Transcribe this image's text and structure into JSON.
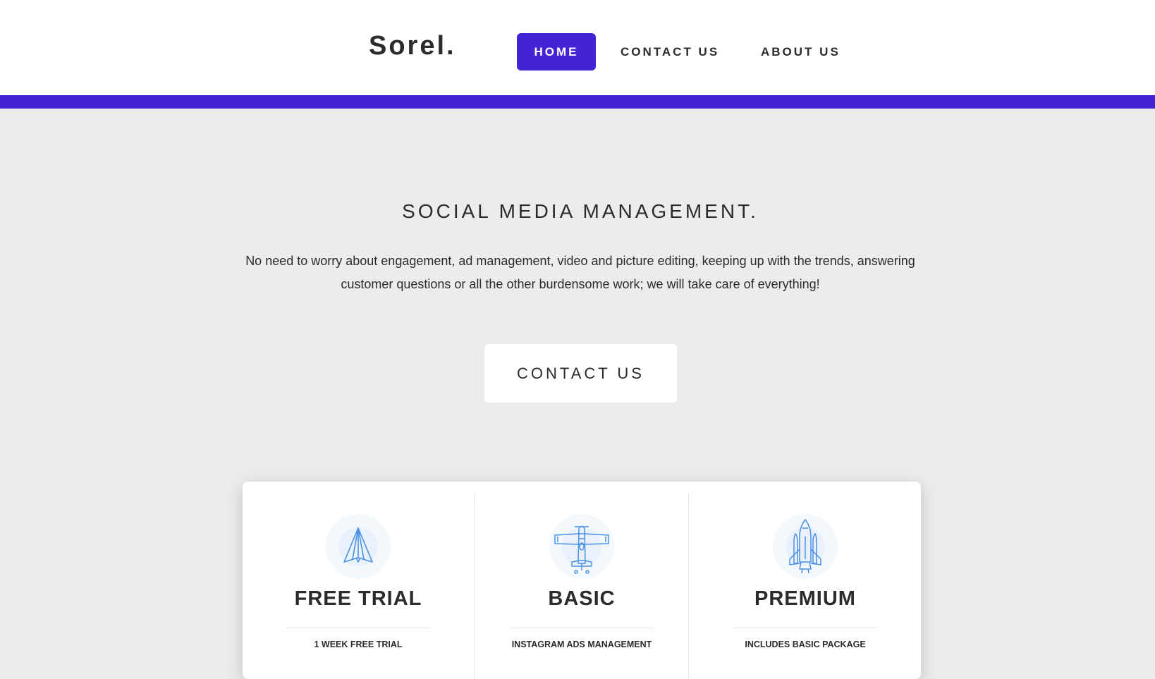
{
  "header": {
    "brand": "Sorel.",
    "nav": [
      {
        "label": "HOME",
        "active": true
      },
      {
        "label": "CONTACT US",
        "active": false
      },
      {
        "label": "ABOUT US",
        "active": false
      }
    ]
  },
  "hero": {
    "title": "SOCIAL MEDIA MANAGEMENT.",
    "description": "No need to worry about engagement, ad management, video and picture editing, keeping up with the trends, answering customer questions or all the other burdensome work; we will take care of everything!",
    "button_label": "CONTACT US"
  },
  "plans": [
    {
      "title": "FREE TRIAL",
      "icon": "paper-plane-icon",
      "feature": "1 WEEK FREE TRIAL"
    },
    {
      "title": "BASIC",
      "icon": "airplane-icon",
      "feature": "INSTAGRAM ADS MANAGEMENT"
    },
    {
      "title": "PREMIUM",
      "icon": "space-shuttle-icon",
      "feature": "INCLUDES BASIC PACKAGE"
    }
  ],
  "colors": {
    "accent": "#4323d3",
    "background": "#ececec",
    "text": "#2b2b2b",
    "icon_stroke": "#4a90e2",
    "icon_bg": "#eef5fc"
  }
}
